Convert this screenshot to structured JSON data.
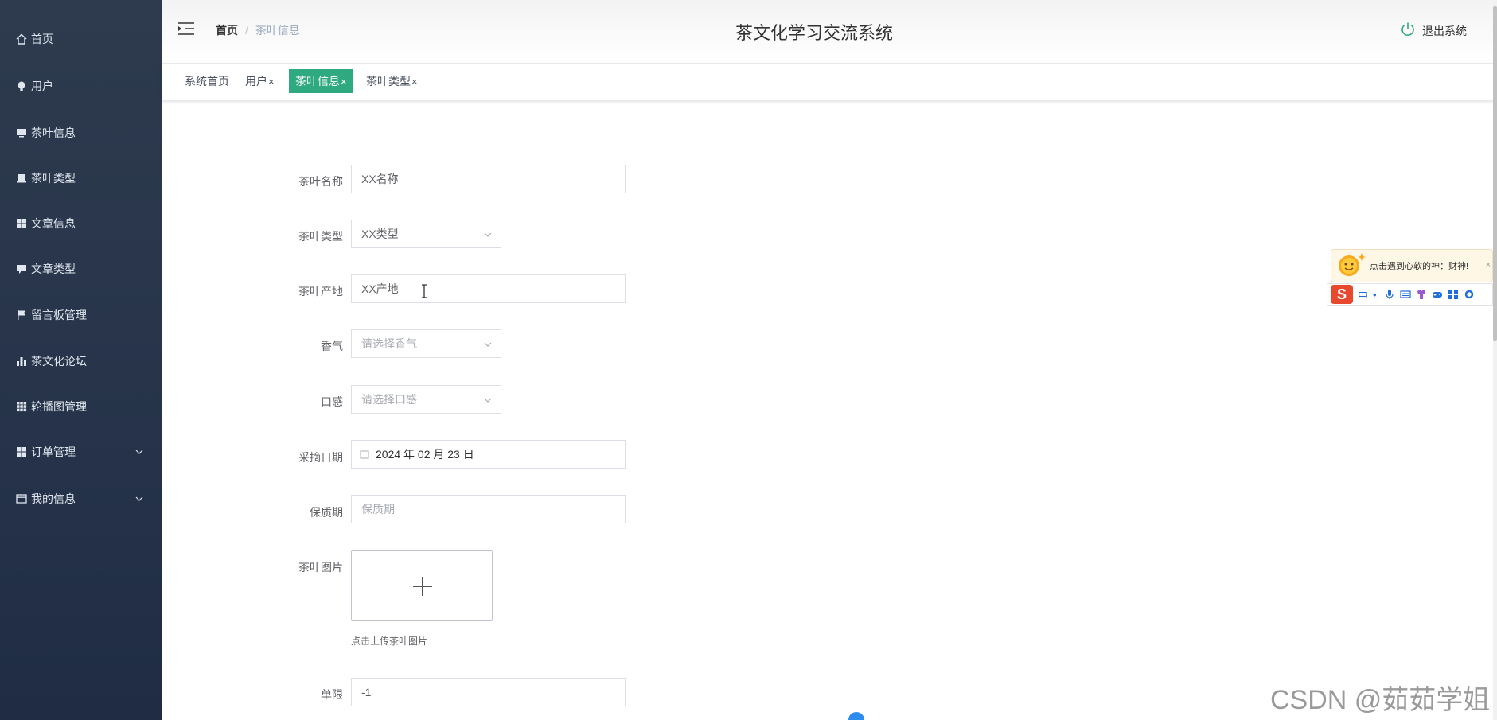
{
  "sidebar": {
    "items": [
      {
        "label": "首页",
        "icon": "home-icon"
      },
      {
        "label": "用户",
        "icon": "bulb-icon"
      },
      {
        "label": "茶叶信息",
        "icon": "monitor-icon"
      },
      {
        "label": "茶叶类型",
        "icon": "printer-icon"
      },
      {
        "label": "文章信息",
        "icon": "grid-icon"
      },
      {
        "label": "文章类型",
        "icon": "comment-icon"
      },
      {
        "label": "留言板管理",
        "icon": "flag-icon"
      },
      {
        "label": "茶文化论坛",
        "icon": "bar-chart-icon"
      },
      {
        "label": "轮播图管理",
        "icon": "apps-icon"
      },
      {
        "label": "订单管理",
        "icon": "grid-icon"
      },
      {
        "label": "我的信息",
        "icon": "card-icon"
      }
    ]
  },
  "header": {
    "breadcrumb_home": "首页",
    "breadcrumb_sep": "/",
    "breadcrumb_current": "茶叶信息",
    "title": "茶文化学习交流系统",
    "logout": "退出系统"
  },
  "tags": [
    {
      "label": "系统首页",
      "closable": false,
      "active": false
    },
    {
      "label": "用户",
      "closable": true,
      "active": false
    },
    {
      "label": "茶叶信息",
      "closable": true,
      "active": true
    },
    {
      "label": "茶叶类型",
      "closable": true,
      "active": false
    }
  ],
  "tag_close": "×",
  "form": {
    "name": {
      "label": "茶叶名称",
      "value": "XX名称"
    },
    "type": {
      "label": "茶叶类型",
      "value": "XX类型"
    },
    "origin": {
      "label": "茶叶产地",
      "value": "XX产地"
    },
    "aroma": {
      "label": "香气",
      "placeholder": "请选择香气"
    },
    "taste": {
      "label": "口感",
      "placeholder": "请选择口感"
    },
    "pick_date": {
      "label": "采摘日期",
      "value": "2024 年 02 月 23 日"
    },
    "shelf_life": {
      "label": "保质期",
      "placeholder": "保质期"
    },
    "image": {
      "label": "茶叶图片",
      "hint": "点击上传茶叶图片"
    },
    "limit": {
      "label": "单限",
      "value": "-1"
    }
  },
  "ime": {
    "tip": "点击遇到心软的神：财神!",
    "close": "×",
    "logo": "S",
    "lang": "中",
    "punct": "•,"
  },
  "watermark": "CSDN @茹茹学姐",
  "colors": {
    "sidebar": "#2e3b4e",
    "active_tag": "#2fa980",
    "ime_logo": "#e8492e"
  }
}
